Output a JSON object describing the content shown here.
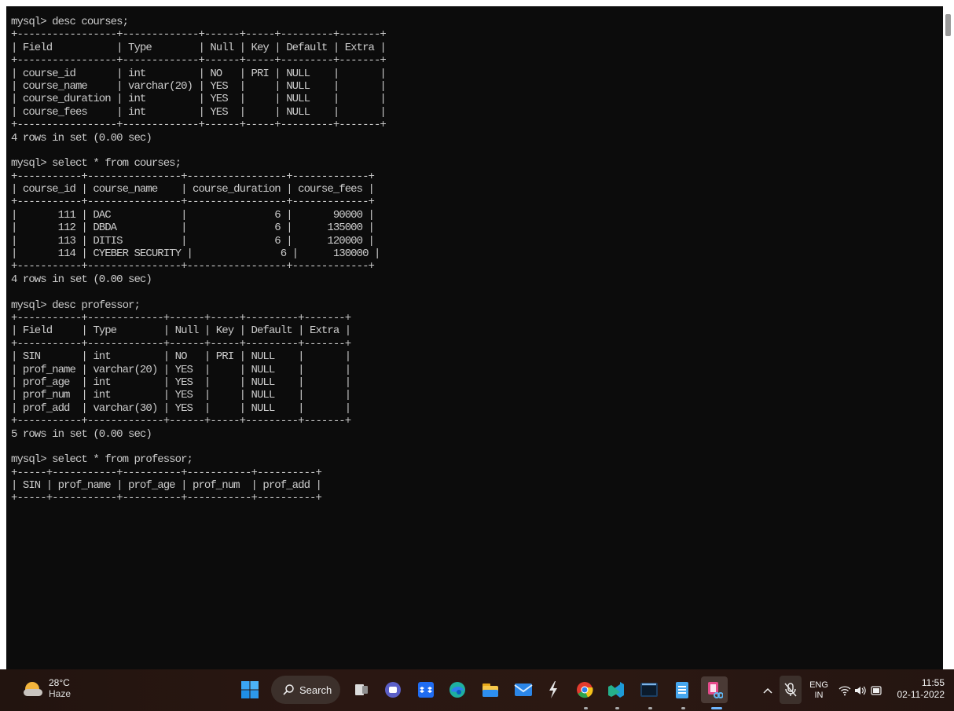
{
  "terminal": {
    "lines": [
      "mysql> desc courses;",
      "+-----------------+-------------+------+-----+---------+-------+",
      "| Field           | Type        | Null | Key | Default | Extra |",
      "+-----------------+-------------+------+-----+---------+-------+",
      "| course_id       | int         | NO   | PRI | NULL    |       |",
      "| course_name     | varchar(20) | YES  |     | NULL    |       |",
      "| course_duration | int         | YES  |     | NULL    |       |",
      "| course_fees     | int         | YES  |     | NULL    |       |",
      "+-----------------+-------------+------+-----+---------+-------+",
      "4 rows in set (0.00 sec)",
      "",
      "mysql> select * from courses;",
      "+-----------+----------------+-----------------+-------------+",
      "| course_id | course_name    | course_duration | course_fees |",
      "+-----------+----------------+-----------------+-------------+",
      "|       111 | DAC            |               6 |       90000 |",
      "|       112 | DBDA           |               6 |      135000 |",
      "|       113 | DITIS          |               6 |      120000 |",
      "|       114 | CYEBER SECURITY |               6 |      130000 |",
      "+-----------+----------------+-----------------+-------------+",
      "4 rows in set (0.00 sec)",
      "",
      "mysql> desc professor;",
      "+-----------+-------------+------+-----+---------+-------+",
      "| Field     | Type        | Null | Key | Default | Extra |",
      "+-----------+-------------+------+-----+---------+-------+",
      "| SIN       | int         | NO   | PRI | NULL    |       |",
      "| prof_name | varchar(20) | YES  |     | NULL    |       |",
      "| prof_age  | int         | YES  |     | NULL    |       |",
      "| prof_num  | int         | YES  |     | NULL    |       |",
      "| prof_add  | varchar(30) | YES  |     | NULL    |       |",
      "+-----------+-------------+------+-----+---------+-------+",
      "5 rows in set (0.00 sec)",
      "",
      "mysql> select * from professor;",
      "+-----+-----------+----------+-----------+----------+",
      "| SIN | prof_name | prof_age | prof_num  | prof_add |",
      "+-----+-----------+----------+-----------+----------+"
    ]
  },
  "taskbar": {
    "weather": {
      "temp": "28°C",
      "condition": "Haze",
      "icon": "haze-sun-icon"
    },
    "search_label": "Search",
    "apps": [
      {
        "name": "start-icon"
      },
      {
        "name": "task-view-icon"
      },
      {
        "name": "chat-icon"
      },
      {
        "name": "dropbox-icon"
      },
      {
        "name": "edge-icon"
      },
      {
        "name": "file-explorer-icon"
      },
      {
        "name": "mail-icon"
      },
      {
        "name": "lightning-app-icon"
      },
      {
        "name": "chrome-icon"
      },
      {
        "name": "vscode-insiders-icon"
      },
      {
        "name": "mysql-console-icon"
      },
      {
        "name": "notepad-icon"
      },
      {
        "name": "snipping-tool-icon"
      }
    ],
    "tray": {
      "language_line1": "ENG",
      "language_line2": "IN",
      "time": "11:55",
      "date": "02-11-2022"
    }
  },
  "colors": {
    "terminal_bg": "#0c0c0c",
    "terminal_fg": "#cccccc",
    "taskbar_bg": "#2a1712"
  }
}
